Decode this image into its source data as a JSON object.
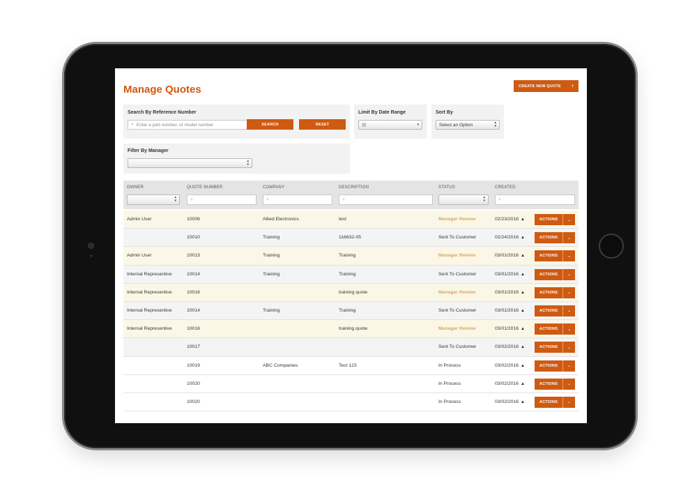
{
  "page": {
    "title": "Manage Quotes",
    "create_button": "CREATE NEW QUOTE"
  },
  "search": {
    "label": "Search By Reference Number",
    "placeholder": "Enter a part number, or model number",
    "search_button": "SEARCH",
    "reset_button": "RESET"
  },
  "date_range": {
    "label": "Limit By Date Range",
    "value": ""
  },
  "sort": {
    "label": "Sort By",
    "value": "Select an Option"
  },
  "manager_filter": {
    "label": "Filter By Manager",
    "value": ""
  },
  "columns": {
    "owner": "OWNER",
    "quote_number": "QUOTE NUMBER",
    "company": "COMPANY",
    "description": "DESCRIPTION",
    "status": "STATUS",
    "created": "CREATED"
  },
  "actions_label": "ACTIONS",
  "rows": [
    {
      "owner": "Admin User",
      "quote": "10006",
      "company": "Allied Electronics",
      "description": "test",
      "status": "Manager Review",
      "created": "02/23/2016"
    },
    {
      "owner": "",
      "quote": "10010",
      "company": "Training",
      "description": "116632-05",
      "status": "Sent To Customer",
      "created": "02/24/2016"
    },
    {
      "owner": "Admin User",
      "quote": "10013",
      "company": "Training",
      "description": "Training",
      "status": "Manager Review",
      "created": "03/01/2016"
    },
    {
      "owner": "Internal Representive",
      "quote": "10014",
      "company": "Training",
      "description": "Training",
      "status": "Sent To Customer",
      "created": "03/01/2016"
    },
    {
      "owner": "Internal Representive",
      "quote": "10016",
      "company": "",
      "description": "training quote",
      "status": "Manager Review",
      "created": "03/01/2016"
    },
    {
      "owner": "Internal Representive",
      "quote": "10014",
      "company": "Training",
      "description": "Training",
      "status": "Sent To Customer",
      "created": "03/01/2016"
    },
    {
      "owner": "Internal Representive",
      "quote": "10016",
      "company": "",
      "description": "training quote",
      "status": "Manager Review",
      "created": "03/01/2016"
    },
    {
      "owner": "",
      "quote": "10017",
      "company": "",
      "description": "",
      "status": "Sent To Customer",
      "created": "03/02/2016"
    },
    {
      "owner": "",
      "quote": "10019",
      "company": "ABC Companies",
      "description": "Test 123",
      "status": "In Process",
      "created": "03/02/2016"
    },
    {
      "owner": "",
      "quote": "10020",
      "company": "",
      "description": "",
      "status": "In Process",
      "created": "03/02/2016"
    },
    {
      "owner": "",
      "quote": "10020",
      "company": "",
      "description": "",
      "status": "In Process",
      "created": "03/02/2016"
    }
  ],
  "colors": {
    "accent": "#cf5a12",
    "title": "#d4570f",
    "review_status": "#d9a75c",
    "highlight_row": "#fbf7e6"
  }
}
